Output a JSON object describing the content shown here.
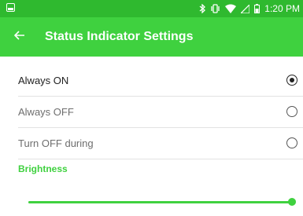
{
  "status_bar": {
    "time": "1:20 PM",
    "icons": [
      "notification-icon",
      "bluetooth-icon",
      "vibrate-icon",
      "wifi-icon",
      "no-signal-icon",
      "battery-icon"
    ]
  },
  "app_bar": {
    "title": "Status Indicator Settings",
    "back_icon": "arrow-left-icon"
  },
  "options": [
    {
      "label": "Always ON",
      "selected": true
    },
    {
      "label": "Always OFF",
      "selected": false
    },
    {
      "label": "Turn OFF during",
      "selected": false
    }
  ],
  "brightness": {
    "header": "Brightness",
    "level": 1.0
  },
  "colors": {
    "status_bar": "#2fb92f",
    "app_bar": "#3fd13f",
    "accent": "#3fd13f"
  }
}
